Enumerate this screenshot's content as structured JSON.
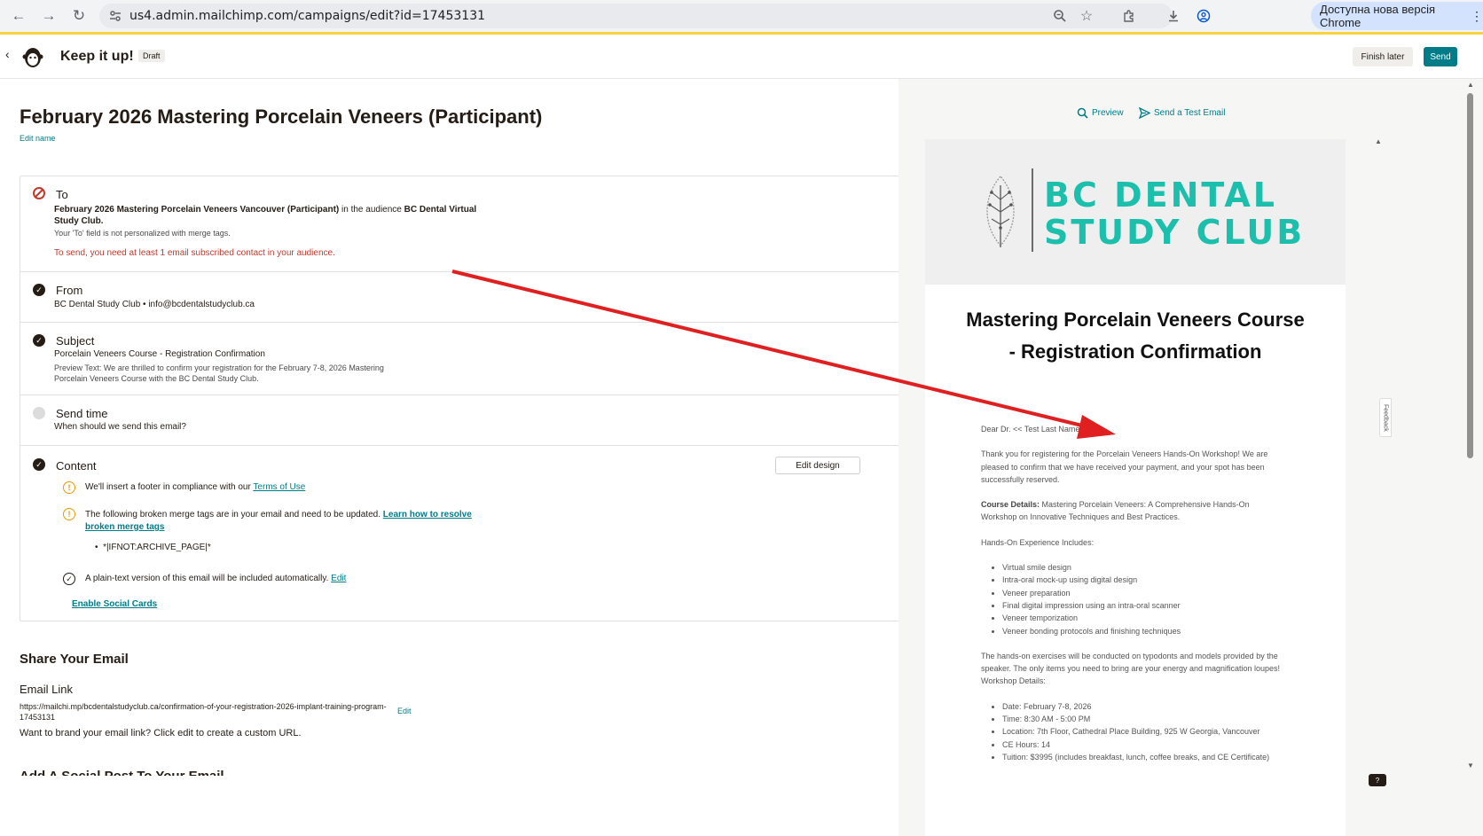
{
  "browser": {
    "url": "us4.admin.mailchimp.com/campaigns/edit?id=17453131",
    "update_label": "Доступна нова версія Chrome"
  },
  "header": {
    "title": "Keep it up!",
    "draft_badge": "Draft",
    "finish_later": "Finish later",
    "send": "Send"
  },
  "campaign": {
    "title": "February 2026 Mastering Porcelain Veneers (Participant)",
    "edit_name": "Edit name"
  },
  "sections": {
    "to": {
      "heading": "To",
      "segment": "February 2026 Mastering Porcelain Veneers Vancouver (Participant)",
      "in_the_audience": "in the audience",
      "audience": "BC Dental Virtual Study Club.",
      "note": "Your 'To' field is not personalized with merge tags.",
      "error": "To send, you need at least 1 email subscribed contact in your audience."
    },
    "from": {
      "heading": "From",
      "value": "BC Dental Study Club • info@bcdentalstudyclub.ca"
    },
    "subject": {
      "heading": "Subject",
      "value": "Porcelain Veneers Course - Registration Confirmation",
      "preview": "Preview Text: We are thrilled to confirm your registration for the February 7-8, 2026 Mastering Porcelain Veneers Course with the BC Dental Study Club."
    },
    "send_time": {
      "heading": "Send time",
      "value": "When should we send this email?"
    },
    "content": {
      "heading": "Content",
      "edit_design": "Edit design",
      "footer_note": "We'll insert a footer in compliance with our",
      "terms_link": "Terms of Use",
      "broken_note": "The following broken merge tags are in your email and need to be updated.",
      "learn_link": "Learn how to resolve broken merge tags",
      "broken_tag": "*|IFNOT:ARCHIVE_PAGE|*",
      "plaintext_note": "A plain-text version of this email will be included automatically.",
      "plaintext_edit": "Edit",
      "social_cards": "Enable Social Cards"
    }
  },
  "share": {
    "heading": "Share Your Email",
    "link_heading": "Email Link",
    "url": "https://mailchi.mp/bcdentalstudyclub.ca/confirmation-of-your-registration-2026-implant-training-program-17453131",
    "edit": "Edit",
    "note": "Want to brand your email link? Click edit to create a custom URL.",
    "next_heading": "Add A Social Post To Your Email"
  },
  "preview": {
    "preview_label": "Preview",
    "test_label": "Send a Test Email",
    "brand_line1": "BC DENTAL",
    "brand_line2": "STUDY CLUB",
    "email_title": "Mastering Porcelain Veneers Course - Registration Confirmation",
    "greeting": "Dear Dr. << Test Last Name >>,",
    "intro": "Thank you for registering for the Porcelain Veneers Hands-On Workshop! We are pleased to confirm that we have received your payment, and your spot has been successfully reserved.",
    "course_details_label": "Course Details:",
    "course_details": "Mastering Porcelain Veneers: A Comprehensive Hands-On Workshop on Innovative Techniques and Best Practices.",
    "hands_on_label": "Hands-On Experience Includes:",
    "hands_on_items": [
      "Virtual smile design",
      "Intra-oral mock-up using digital design",
      "Veneer preparation",
      "Final digital impression using an intra-oral scanner",
      "Veneer temporization",
      "Veneer bonding protocols and finishing techniques"
    ],
    "exercises": "The hands-on exercises will be conducted on typodonts and models provided by the speaker. The only items you need to bring are your energy and magnification loupes! Workshop Details:",
    "details_items": [
      "Date: February 7-8, 2026",
      "Time: 8:30 AM - 5:00 PM",
      "Location: 7th Floor, Cathedral Place Building, 925 W Georgia, Vancouver",
      "CE Hours: 14",
      "Tuition: $3995 (includes breakfast, lunch, coffee breaks, and CE Certificate)"
    ]
  },
  "feedback_label": "Feedback",
  "help_label": "?",
  "colors": {
    "accent": "#007c89",
    "brand_teal": "#1bbfab",
    "error": "#c2392d",
    "warning": "#e49a00",
    "annotation_arrow": "#e02020"
  }
}
